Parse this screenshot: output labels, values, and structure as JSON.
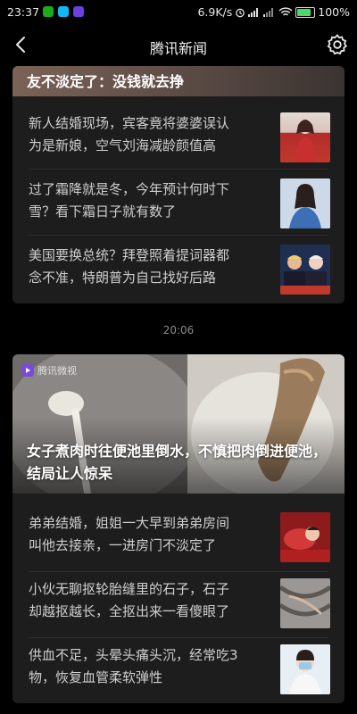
{
  "status_bar": {
    "time": "23:37",
    "speed": "6.9K/s",
    "battery": "100%"
  },
  "header": {
    "title": "腾讯新闻"
  },
  "card1": {
    "banner_caption": "友不淡定了：没钱就去挣",
    "items": [
      {
        "line1": "新人结婚现场，宾客竟将婆婆误认",
        "line2": "为是新娘，空气刘海减龄颜值高"
      },
      {
        "line1": "过了霜降就是冬，今年预计何时下",
        "line2": "雪？看下霜日子就有数了"
      },
      {
        "line1": "美国要换总统？拜登照着提词器都",
        "line2": "念不准，特朗普为自己找好后路"
      }
    ]
  },
  "timestamp": "20:06",
  "card2": {
    "hero_badge": "腾讯微视",
    "hero_line1": "女子煮肉时往便池里倒水，不慎把肉倒进便池，",
    "hero_line2": "结局让人惊呆",
    "items": [
      {
        "line1": "弟弟结婚，姐姐一大早到弟弟房间",
        "line2": "叫他去接亲，一进房门不淡定了"
      },
      {
        "line1": "小伙无聊抠轮胎缝里的石子，石子",
        "line2": "却越抠越长，全抠出来一看傻眼了"
      },
      {
        "line1": "供血不足，头晕头痛头沉，经常吃3",
        "line2": "物，恢复血管柔软弹性"
      }
    ]
  }
}
